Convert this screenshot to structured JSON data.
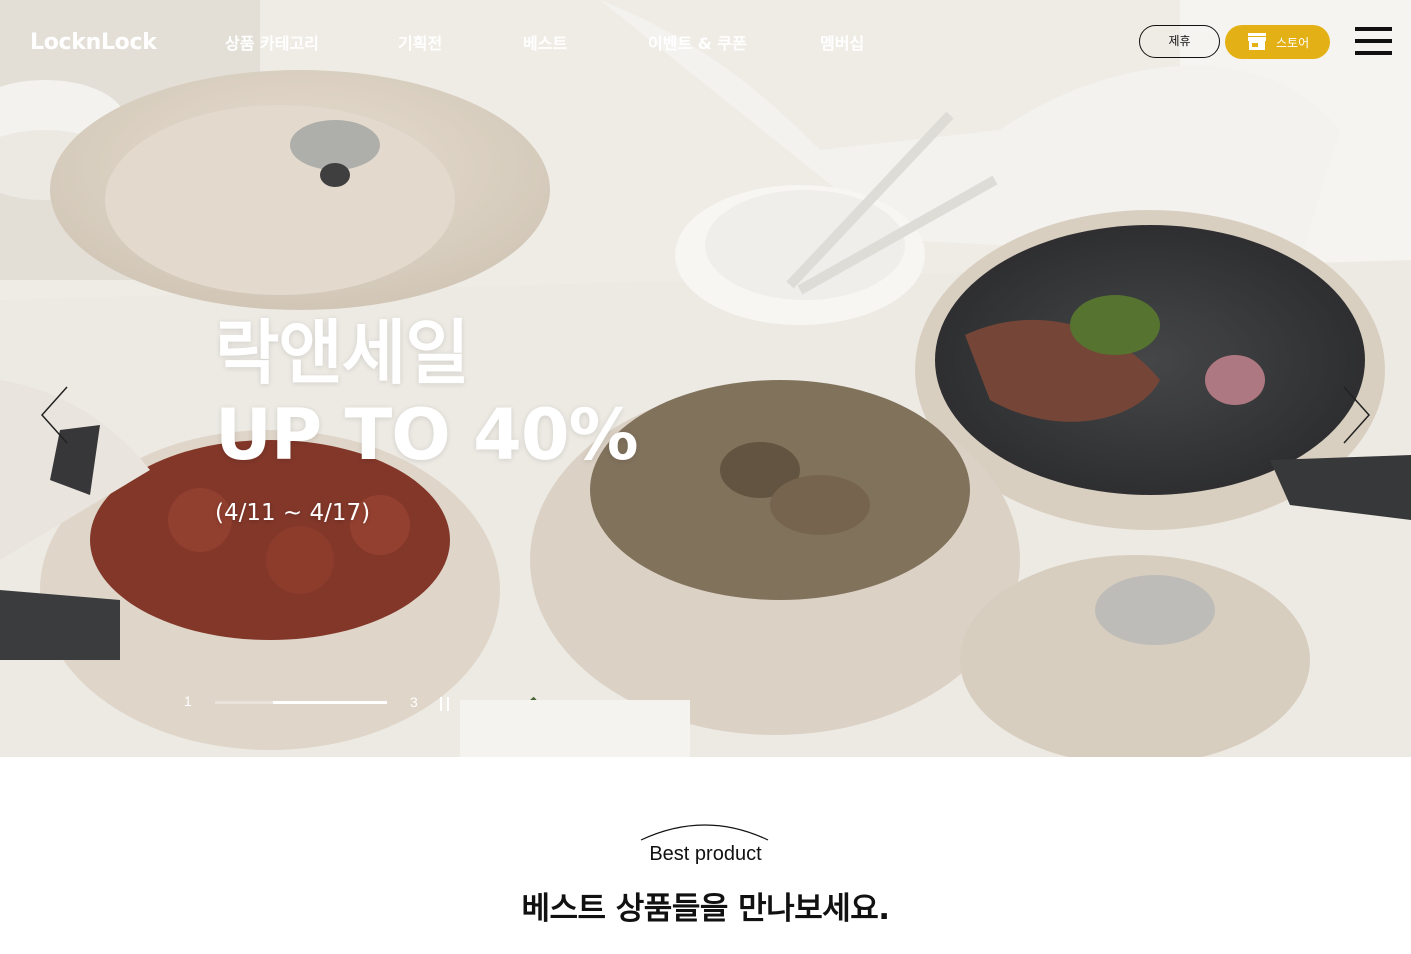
{
  "header": {
    "logo": "LocknLock",
    "nav": [
      {
        "label": "상품 카테고리"
      },
      {
        "label": "기획전"
      },
      {
        "label": "베스트"
      },
      {
        "label": "이벤트 & 쿠폰"
      },
      {
        "label": "멤버십"
      }
    ],
    "partner_label": "제휴",
    "store_label": "스토어",
    "store_color": "#e3b115"
  },
  "hero": {
    "title_line1": "락앤세일",
    "title_line2": "UP TO 40%",
    "date_range": "(4/11 ~ 4/17)",
    "pager": {
      "current": "1",
      "total": "3",
      "progress_fraction": 0.66
    }
  },
  "best": {
    "label": "Best product",
    "heading": "베스트 상품들을 만나보세요."
  }
}
